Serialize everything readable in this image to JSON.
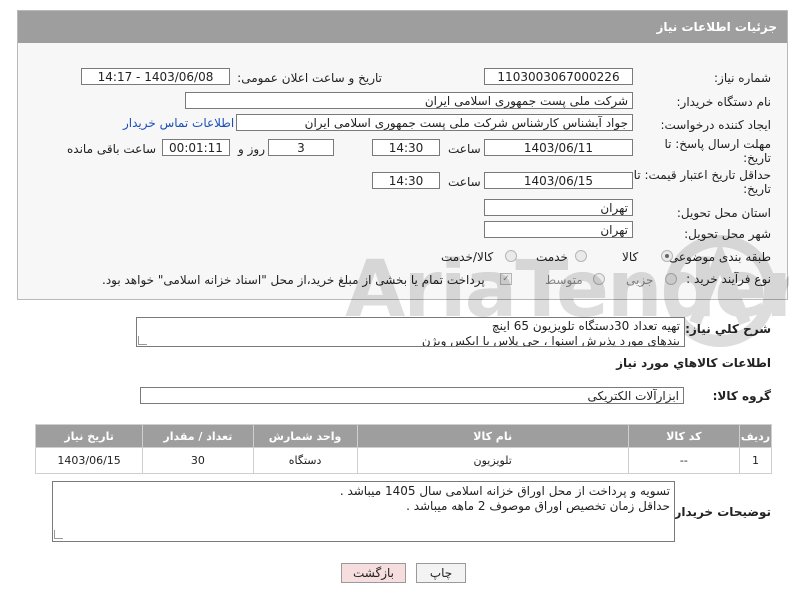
{
  "header": {
    "title": "جزئیات اطلاعات نیاز"
  },
  "form": {
    "need_number": {
      "label": "شماره نیاز:",
      "value": "1103003067000226"
    },
    "announce": {
      "label": "تاریخ و ساعت اعلان عمومی:",
      "value": "1403/06/08 - 14:17"
    },
    "buyer": {
      "label": "نام دستگاه خریدار:",
      "value": "شرکت ملی پست جمهوری اسلامی ایران"
    },
    "requester": {
      "label": "ایجاد کننده درخواست:",
      "value": "جواد آبشناس کارشناس شرکت ملی پست جمهوری اسلامی ایران",
      "contact_link": "اطلاعات تماس خریدار"
    },
    "deadline": {
      "label_line1": "مهلت ارسال پاسخ: تا",
      "label_line2": "تاریخ:",
      "date": "1403/06/11",
      "time_label": "ساعت",
      "time": "14:30",
      "days": "3",
      "days_label": "روز و",
      "remaining": "00:01:11",
      "remaining_label": "ساعت باقی مانده"
    },
    "validity": {
      "label_line1": "حداقل تاریخ اعتبار قیمت: تا",
      "label_line2": "تاریخ:",
      "date": "1403/06/15",
      "time_label": "ساعت",
      "time": "14:30"
    },
    "province": {
      "label": "استان محل تحویل:",
      "value": "تهران"
    },
    "city": {
      "label": "شهر محل تحویل:",
      "value": "تهران"
    },
    "category": {
      "label": "طبقه بندی موضوعی:",
      "options": [
        "کالا",
        "خدمت",
        "کالا/خدمت"
      ],
      "selected": "کالا"
    },
    "process": {
      "label": "نوع فرآیند خرید :",
      "options": [
        "جزیی",
        "متوسط"
      ],
      "payment_note": "پرداخت تمام یا بخشی از مبلغ خرید،از محل \"اسناد خزانه اسلامی\" خواهد بود."
    }
  },
  "description": {
    "label": "شرح کلي نياز:",
    "text": "تهیه تعداد 30دستگاه  تلویزیون 65 اینچ\nبندهای مورد پذیرش اسنوا ، جی پلاس یا ایکس ویژن"
  },
  "goods": {
    "section_title": "اطلاعات کالاهاي مورد نياز",
    "group_label": "گروه کالا:",
    "group_value": "ابزارآلات الکتریکی",
    "columns": [
      "ردیف",
      "کد کالا",
      "نام کالا",
      "واحد شمارش",
      "تعداد / مقدار",
      "تاریخ نیاز"
    ],
    "rows": [
      [
        "1",
        "--",
        "تلویزیون",
        "دستگاه",
        "30",
        "1403/06/15"
      ]
    ]
  },
  "buyer_notes": {
    "label": "توضیحات خریدار:",
    "text": "تسویه و پرداخت از محل اوراق خزانه اسلامی سال 1405  میباشد .\nحداقل زمان تخصیص اوراق موصوف 2 ماهه میباشد ."
  },
  "buttons": {
    "print": "چاپ",
    "back": "بازگشت"
  },
  "watermark": {
    "text": "AriaTender.neT"
  },
  "colors": {
    "header_bg": "#9e9e9e",
    "link": "#1a4fb8",
    "back_button_bg": "#f7dede"
  }
}
